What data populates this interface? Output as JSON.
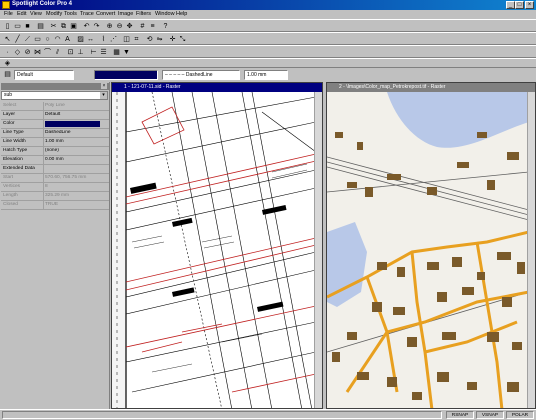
{
  "app": {
    "title": "Spotlight Color Pro 4"
  },
  "menu": [
    "File",
    "Edit",
    "View",
    "Modify",
    "Tools",
    "Trace",
    "Convert",
    "Image",
    "Filters",
    "Window",
    "Help"
  ],
  "propbar": {
    "layer": "Default",
    "line_type": "DashedLine",
    "width": "1.00 mm"
  },
  "left_panel": {
    "selection": "sub",
    "rows": [
      {
        "k": "Select",
        "v": "Poly Line",
        "dis": true
      },
      {
        "k": "Layer",
        "v": "Default",
        "dis": false
      },
      {
        "k": "Color",
        "v": "",
        "dis": false,
        "swatch": "#000060"
      },
      {
        "k": "Line Type",
        "v": "DashedLine",
        "dis": false
      },
      {
        "k": "Line Width",
        "v": "1.00 mm",
        "dis": false
      },
      {
        "k": "Hatch Type",
        "v": "(none)",
        "dis": false
      },
      {
        "k": "Elevation",
        "v": "0.00 mm",
        "dis": false
      },
      {
        "k": "Extended Data",
        "v": "",
        "dis": false
      },
      {
        "k": "Start",
        "v": "570.60, 756.75 mm",
        "dis": true
      },
      {
        "k": "Vertices",
        "v": "8",
        "dis": true
      },
      {
        "k": "Length",
        "v": "325.29 mm",
        "dis": true
      },
      {
        "k": "Closed",
        "v": "TRUE",
        "dis": true
      }
    ]
  },
  "docs": [
    {
      "title": "1 - 121-07-11.sid - Raster",
      "active": true
    },
    {
      "title": "2 - \\Images\\Color_map_Petrokrepost.tif - Raster",
      "active": false
    }
  ],
  "status": [
    "RSNAP",
    "VSNAP",
    "POLAR"
  ],
  "colors": {
    "title_active": "#000080",
    "map_orange": "#e8a020",
    "map_building": "#7a5a2a",
    "map_water": "#b8c8e8"
  }
}
